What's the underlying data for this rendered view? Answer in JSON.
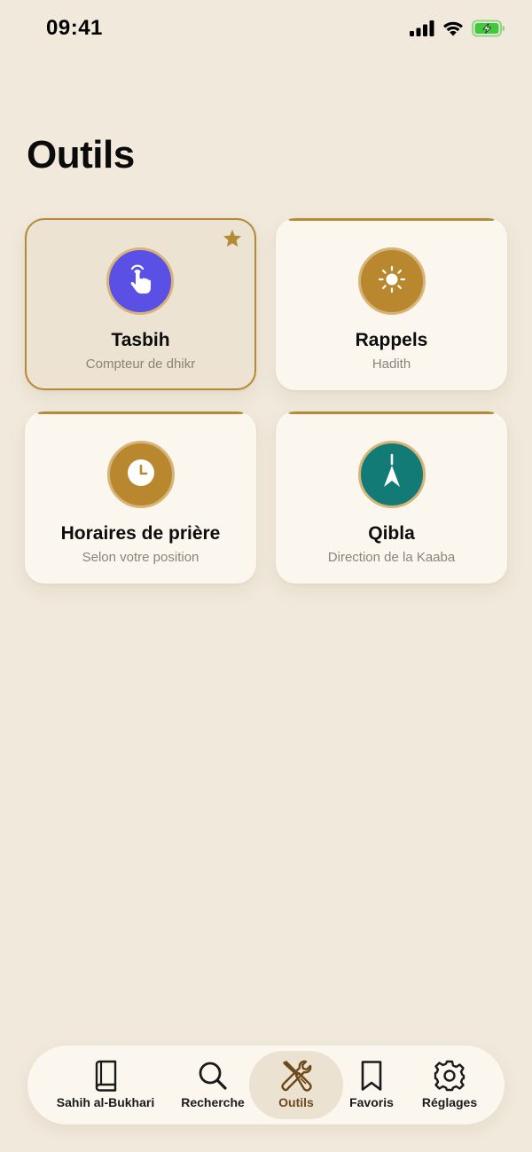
{
  "status_bar": {
    "time": "09:41",
    "icons": [
      "signal-icon",
      "wifi-icon",
      "battery-charging-icon"
    ]
  },
  "page": {
    "title": "Outils"
  },
  "tools": [
    {
      "title": "Tasbih",
      "subtitle": "Compteur de dhikr",
      "icon": "tap-hand-icon",
      "icon_color": "#5b50e6",
      "selected": true,
      "favorite": true
    },
    {
      "title": "Rappels",
      "subtitle": "Hadith",
      "icon": "sun-icon",
      "icon_color": "#b9882e",
      "selected": false,
      "favorite": false
    },
    {
      "title": "Horaires de prière",
      "subtitle": "Selon votre position",
      "icon": "clock-icon",
      "icon_color": "#b9882e",
      "selected": false,
      "favorite": false
    },
    {
      "title": "Qibla",
      "subtitle": "Direction de la Kaaba",
      "icon": "compass-arrow-icon",
      "icon_color": "#137b75",
      "selected": false,
      "favorite": false
    }
  ],
  "tab_bar": {
    "tabs": [
      {
        "label": "Sahih al-Bukhari",
        "icon": "book-icon",
        "active": false
      },
      {
        "label": "Recherche",
        "icon": "search-icon",
        "active": false
      },
      {
        "label": "Outils",
        "icon": "tools-icon",
        "active": true
      },
      {
        "label": "Favoris",
        "icon": "bookmark-icon",
        "active": false
      },
      {
        "label": "Réglages",
        "icon": "gear-icon",
        "active": false
      }
    ]
  },
  "colors": {
    "background": "#f1e9dc",
    "card": "#fbf7ef",
    "accent_gold": "#b58a36",
    "tasbih_purple": "#5b50e6",
    "qibla_teal": "#137b75",
    "battery_green": "#3ec93e"
  }
}
